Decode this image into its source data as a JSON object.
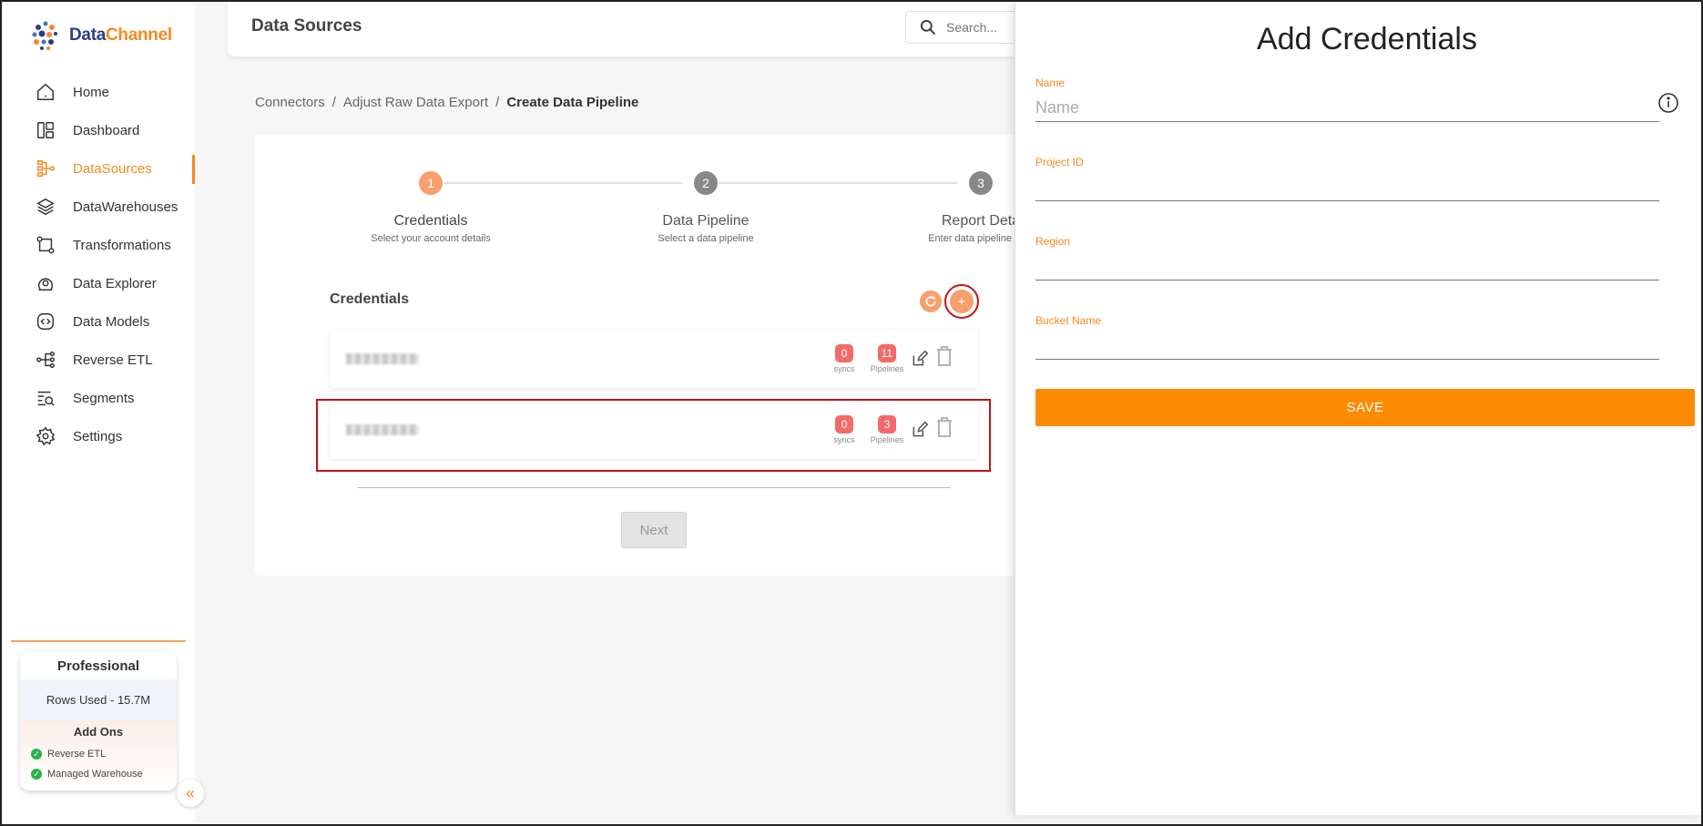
{
  "app": {
    "logo_part1": "Data",
    "logo_part2": "Channel"
  },
  "sidebar": {
    "items": [
      {
        "label": "Home",
        "icon": "home-icon"
      },
      {
        "label": "Dashboard",
        "icon": "dashboard-icon"
      },
      {
        "label": "DataSources",
        "icon": "datasources-icon",
        "active": true
      },
      {
        "label": "DataWarehouses",
        "icon": "layers-icon"
      },
      {
        "label": "Transformations",
        "icon": "transform-icon"
      },
      {
        "label": "Data Explorer",
        "icon": "explorer-icon"
      },
      {
        "label": "Data Models",
        "icon": "models-icon"
      },
      {
        "label": "Reverse ETL",
        "icon": "reverse-etl-icon"
      },
      {
        "label": "Segments",
        "icon": "segments-icon"
      },
      {
        "label": "Settings",
        "icon": "gear-icon"
      }
    ],
    "plan": {
      "title": "Professional",
      "rows_used": "Rows Used - 15.7M",
      "addons_title": "Add Ons",
      "addons": [
        "Reverse ETL",
        "Managed Warehouse"
      ]
    },
    "collapse_glyph": "«"
  },
  "header": {
    "title": "Data Sources",
    "search_placeholder": "Search..."
  },
  "breadcrumb": [
    "Connectors",
    "/",
    "Adjust Raw Data Export",
    "/",
    "Create Data Pipeline"
  ],
  "steps": [
    {
      "number": "1",
      "title": "Credentials",
      "subtitle": "Select your account details",
      "active": true
    },
    {
      "number": "2",
      "title": "Data Pipeline",
      "subtitle": "Select a data pipeline",
      "active": false
    },
    {
      "number": "3",
      "title": "Report Deta",
      "subtitle": "Enter data pipeline conf",
      "active": false
    }
  ],
  "credentials": {
    "title": "Credentials",
    "rows": [
      {
        "syncs": "0",
        "syncs_label": "syncs",
        "pipelines": "11",
        "pipelines_label": "Pipelines"
      },
      {
        "syncs": "0",
        "syncs_label": "syncs",
        "pipelines": "3",
        "pipelines_label": "Pipelines"
      }
    ],
    "add_glyph": "+"
  },
  "next_label": "Next",
  "drawer": {
    "title": "Add Credentials",
    "fields": [
      {
        "label": "Name",
        "placeholder": "Name",
        "value": ""
      },
      {
        "label": "Project ID",
        "placeholder": "",
        "value": ""
      },
      {
        "label": "Region",
        "placeholder": "",
        "value": ""
      },
      {
        "label": "Bucket Name",
        "placeholder": "",
        "value": ""
      }
    ],
    "save_label": "SAVE"
  },
  "colors": {
    "accent": "#f58a1f",
    "save": "#fb8b02",
    "badge": "#f26b6b",
    "highlight": "#c0121a"
  }
}
